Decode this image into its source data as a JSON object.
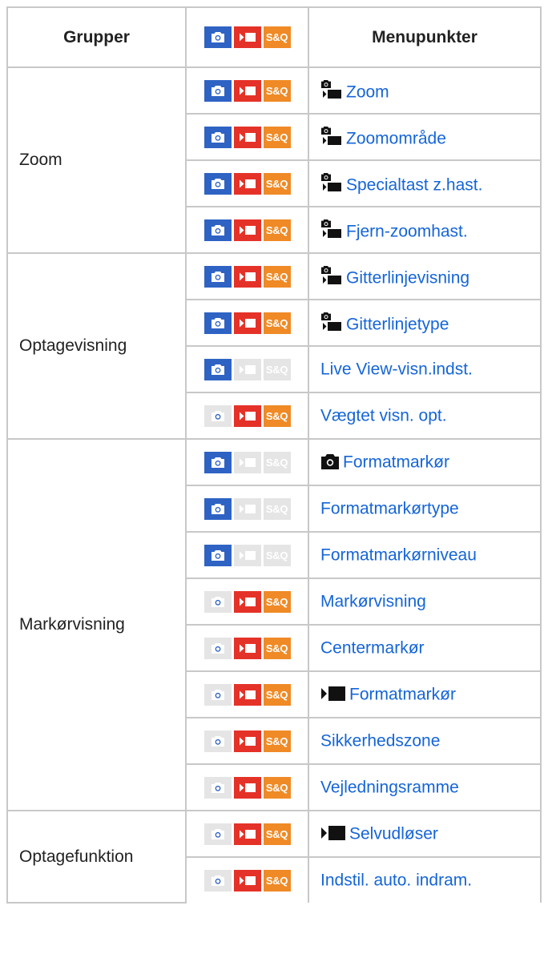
{
  "headers": {
    "col1": "Grupper",
    "col3": "Menupunkter"
  },
  "header_modes": {
    "photo": true,
    "movie": true,
    "sq": true
  },
  "badge_label": "S&Q",
  "colors": {
    "photo": "#2e63c4",
    "movie": "#e53228",
    "sq": "#ef8a26",
    "disabled": "#e5e5e5",
    "link": "#1565d8"
  },
  "rows": [
    {
      "group": "Zoom",
      "rowspan": 4,
      "photo": true,
      "movie": true,
      "sq": true,
      "prefix": "photo-movie-icon",
      "label": "Zoom"
    },
    {
      "photo": true,
      "movie": true,
      "sq": true,
      "prefix": "photo-movie-icon",
      "label": "Zoomområde"
    },
    {
      "photo": true,
      "movie": true,
      "sq": true,
      "prefix": "photo-movie-icon",
      "label": "Specialtast z.hast."
    },
    {
      "photo": true,
      "movie": true,
      "sq": true,
      "prefix": "photo-movie-icon",
      "label": "Fjern-zoomhast."
    },
    {
      "group": "Optagevisning",
      "rowspan": 4,
      "photo": true,
      "movie": true,
      "sq": true,
      "prefix": "photo-movie-icon",
      "label": "Gitterlinjevisning"
    },
    {
      "photo": true,
      "movie": true,
      "sq": true,
      "prefix": "photo-movie-icon",
      "label": "Gitterlinjetype"
    },
    {
      "photo": true,
      "movie": false,
      "sq": false,
      "prefix": "",
      "label": "Live View-visn.indst."
    },
    {
      "photo": false,
      "movie": true,
      "sq": true,
      "prefix": "",
      "label": "Vægtet visn. opt."
    },
    {
      "group": "Markørvisning",
      "rowspan": 8,
      "photo": true,
      "movie": false,
      "sq": false,
      "prefix": "camera-icon",
      "label": "Formatmarkør"
    },
    {
      "photo": true,
      "movie": false,
      "sq": false,
      "prefix": "",
      "label": "Formatmarkørtype"
    },
    {
      "photo": true,
      "movie": false,
      "sq": false,
      "prefix": "",
      "label": "Formatmarkørniveau"
    },
    {
      "photo": false,
      "movie": true,
      "sq": true,
      "prefix": "",
      "label": "Markørvisning"
    },
    {
      "photo": false,
      "movie": true,
      "sq": true,
      "prefix": "",
      "label": "Centermarkør"
    },
    {
      "photo": false,
      "movie": true,
      "sq": true,
      "prefix": "movie-icon",
      "label": "Formatmarkør"
    },
    {
      "photo": false,
      "movie": true,
      "sq": true,
      "prefix": "",
      "label": "Sikkerhedszone"
    },
    {
      "photo": false,
      "movie": true,
      "sq": true,
      "prefix": "",
      "label": "Vejledningsramme"
    },
    {
      "group": "Optagefunktion",
      "rowspan": 2,
      "photo": false,
      "movie": true,
      "sq": true,
      "prefix": "movie-icon",
      "label": "Selvudløser"
    },
    {
      "photo": false,
      "movie": true,
      "sq": true,
      "prefix": "",
      "label": "Indstil. auto. indram."
    }
  ]
}
